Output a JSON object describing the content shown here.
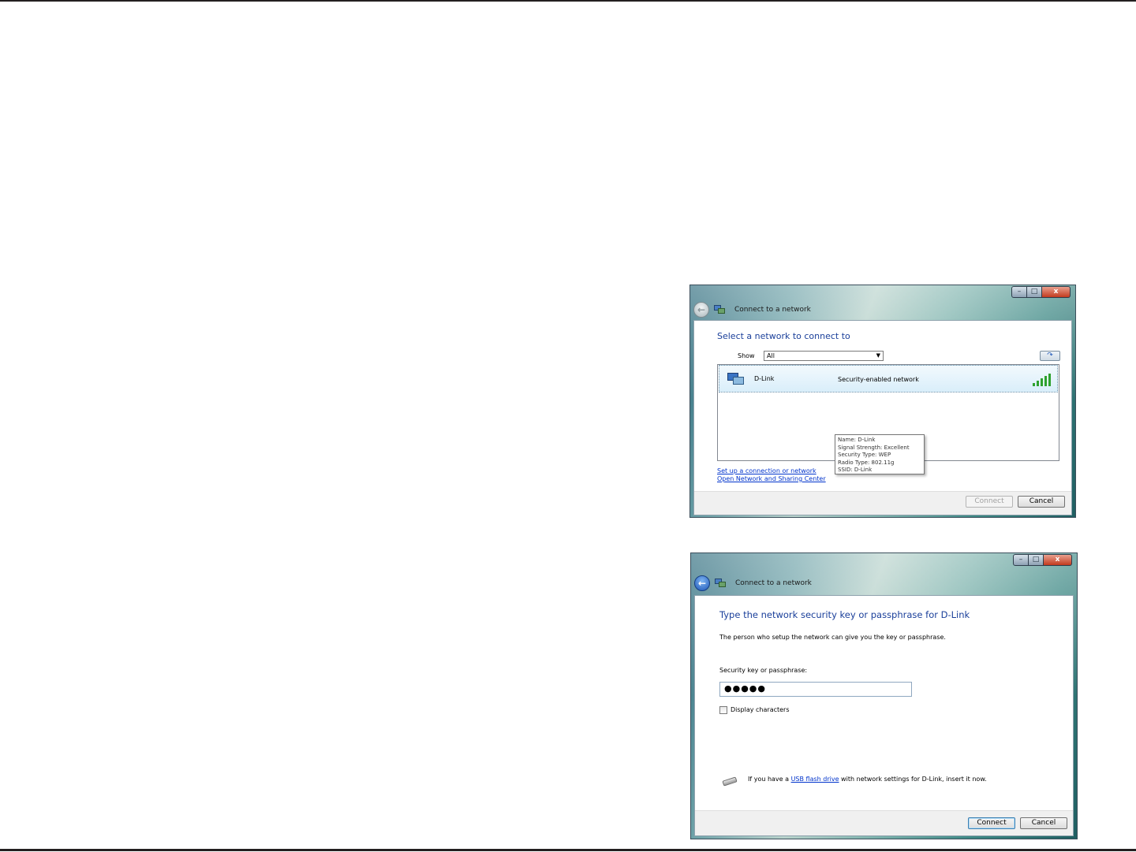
{
  "window1": {
    "controls": {
      "minimize": "–",
      "maximize": "□",
      "close": "x"
    },
    "title": "Connect to a network",
    "heading": "Select a network to connect to",
    "show_label": "Show",
    "show_value": "All",
    "network": {
      "name": "D-Link",
      "security": "Security-enabled network",
      "signal_bars": 5
    },
    "tooltip": [
      "Name: D-Link",
      "Signal Strength: Excellent",
      "Security Type: WEP",
      "Radio Type: 802.11g",
      "SSID: D-Link"
    ],
    "links": {
      "setup": "Set up a connection or network",
      "sharing": "Open Network and Sharing Center"
    },
    "buttons": {
      "connect": "Connect",
      "cancel": "Cancel"
    }
  },
  "window2": {
    "controls": {
      "minimize": "–",
      "maximize": "□",
      "close": "x"
    },
    "title": "Connect to a network",
    "heading": "Type the network security key or passphrase for D-Link",
    "description": "The person who setup the network can give you the key or passphrase.",
    "key_label": "Security key or passphrase:",
    "key_value": "●●●●●",
    "display_characters": "Display characters",
    "usb": {
      "prefix": "If you have a ",
      "link": "USB flash drive",
      "suffix": " with network settings for D-Link, insert it now."
    },
    "buttons": {
      "connect": "Connect",
      "cancel": "Cancel"
    }
  },
  "colors": {
    "heading": "#1a3f9a",
    "link": "#0033cc",
    "signal": "#2ea12e",
    "rule": "#231f20"
  }
}
